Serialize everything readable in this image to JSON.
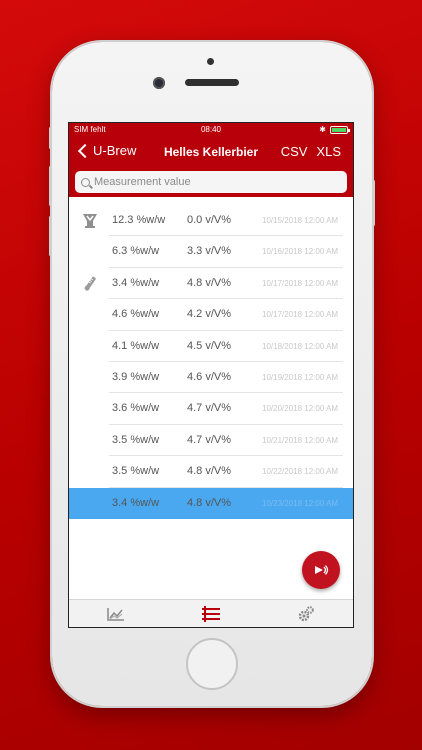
{
  "status": {
    "carrier": "SIM fehlt",
    "time": "08:40"
  },
  "nav": {
    "back_label": "U-Brew",
    "title": "Helles Kellerbier",
    "csv_label": "CSV",
    "xls_label": "XLS"
  },
  "search": {
    "placeholder": "Measurement value",
    "value": ""
  },
  "rows": [
    {
      "sg": "12.3 %w/w",
      "abv": "0.0 v/V%",
      "ts": "10/15/2018 12:00 AM",
      "icon": "beer-glass-icon"
    },
    {
      "sg": "6.3 %w/w",
      "abv": "3.3 v/V%",
      "ts": "10/16/2018 12:00 AM",
      "icon": ""
    },
    {
      "sg": "3.4 %w/w",
      "abv": "4.8 v/V%",
      "ts": "10/17/2018 12:00 AM",
      "icon": "hydrometer-icon"
    },
    {
      "sg": "4.6 %w/w",
      "abv": "4.2 v/V%",
      "ts": "10/17/2018 12:00 AM",
      "icon": ""
    },
    {
      "sg": "4.1 %w/w",
      "abv": "4.5 v/V%",
      "ts": "10/18/2018 12:00 AM",
      "icon": ""
    },
    {
      "sg": "3.9 %w/w",
      "abv": "4.6 v/V%",
      "ts": "10/19/2018 12:00 AM",
      "icon": ""
    },
    {
      "sg": "3.6 %w/w",
      "abv": "4.7 v/V%",
      "ts": "10/20/2018 12:00 AM",
      "icon": ""
    },
    {
      "sg": "3.5 %w/w",
      "abv": "4.7 v/V%",
      "ts": "10/21/2018 12:00 AM",
      "icon": ""
    },
    {
      "sg": "3.5 %w/w",
      "abv": "4.8 v/V%",
      "ts": "10/22/2018 12:00 AM",
      "icon": ""
    },
    {
      "sg": "3.4 %w/w",
      "abv": "4.8 v/V%",
      "ts": "10/23/2018 12:00 AM",
      "icon": "",
      "selected": true
    }
  ],
  "fab": {
    "icon": "play-sound-icon"
  },
  "tabs": [
    {
      "icon": "chart-icon",
      "active": false
    },
    {
      "icon": "list-icon",
      "active": true
    },
    {
      "icon": "settings-gears-icon",
      "active": false
    }
  ],
  "colors": {
    "header": "#b8000b",
    "selected_row": "#4aa8f0",
    "accent": "#c1121f",
    "battery": "#4cd964"
  }
}
